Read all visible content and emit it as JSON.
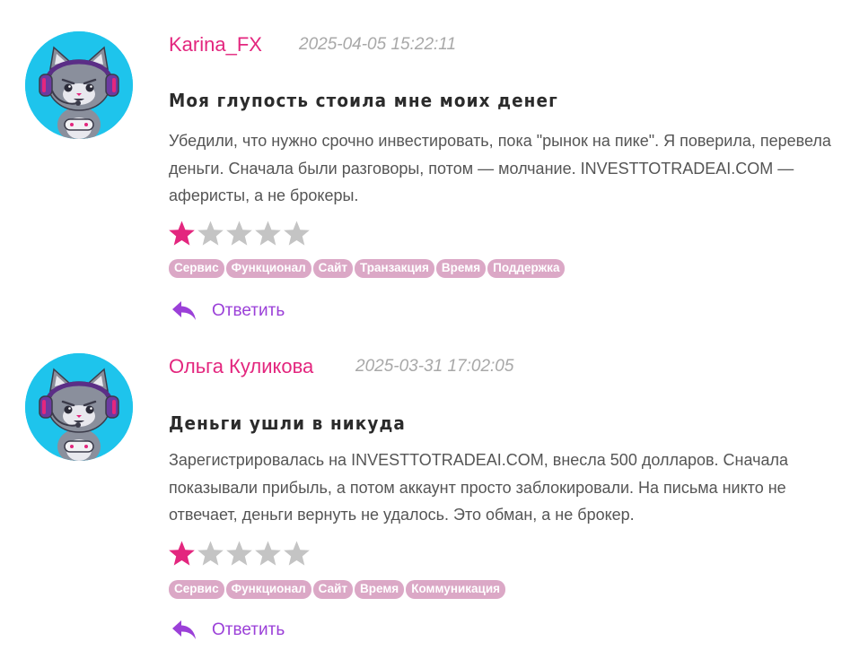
{
  "reviews": [
    {
      "author": "Karina_FX",
      "date": "2025-04-05 15:22:11",
      "title": "Моя глупость стоила мне моих денег",
      "text": "Убедили, что нужно срочно инвестировать, пока \"рынок на пике\". Я поверила, перевела деньги. Сначала были разговоры, потом — молчание. INVESTTOTRADEAI.COM — аферисты, а не брокеры.",
      "rating": 1,
      "rating_max": 5,
      "tags": [
        "Сервис",
        "Функционал",
        "Сайт",
        "Транзакция",
        "Время",
        "Поддержка"
      ],
      "reply_label": "Ответить"
    },
    {
      "author": "Ольга Куликова",
      "date": "2025-03-31 17:02:05",
      "title": "Деньги ушли в никуда",
      "text": "Зарегистрировалась на INVESTTOTRADEAI.COM, внесла 500 долларов. Сначала показывали прибыль, а потом аккаунт просто заблокировали. На письма никто не отвечает, деньги вернуть не удалось. Это обман, а не брокер.",
      "rating": 1,
      "rating_max": 5,
      "tags": [
        "Сервис",
        "Функционал",
        "Сайт",
        "Время",
        "Коммуникация"
      ],
      "reply_label": "Ответить"
    }
  ],
  "colors": {
    "author": "#e3267e",
    "star_filled": "#e3267e",
    "star_empty": "#c4c4c4",
    "tag_bg": "#dba8c6",
    "reply": "#9b40d8",
    "avatar_bg": "#1ec4ec"
  },
  "icons": {
    "avatar": "cat-gamer-avatar-icon",
    "star": "star-icon",
    "reply": "reply-arrow-icon"
  }
}
